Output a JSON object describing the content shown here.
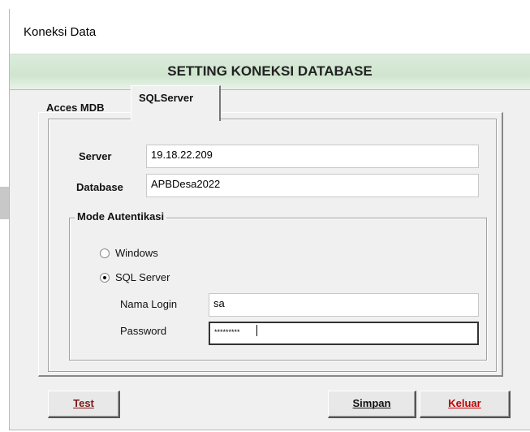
{
  "window": {
    "title": "Koneksi Data"
  },
  "header": {
    "heading": "SETTING KONEKSI DATABASE"
  },
  "tabs": [
    {
      "label": "Acces MDB",
      "active": false
    },
    {
      "label": "SQLServer",
      "active": true
    }
  ],
  "connection": {
    "server_label": "Server",
    "server_value": "19.18.22.209",
    "database_label": "Database",
    "database_value": "APBDesa2022"
  },
  "auth": {
    "group_label": "Mode Autentikasi",
    "options": [
      {
        "label": "Windows",
        "selected": false
      },
      {
        "label": "SQL Server",
        "selected": true
      }
    ],
    "login_label": "Nama Login",
    "login_value": "sa",
    "password_label": "Password",
    "password_value": "*********"
  },
  "buttons": {
    "test": "Test",
    "simpan": "Simpan",
    "keluar": "Keluar"
  },
  "colors": {
    "header_band": "#cfe5cf",
    "keluar_text": "#c00000",
    "test_text": "#7a1a1a"
  }
}
